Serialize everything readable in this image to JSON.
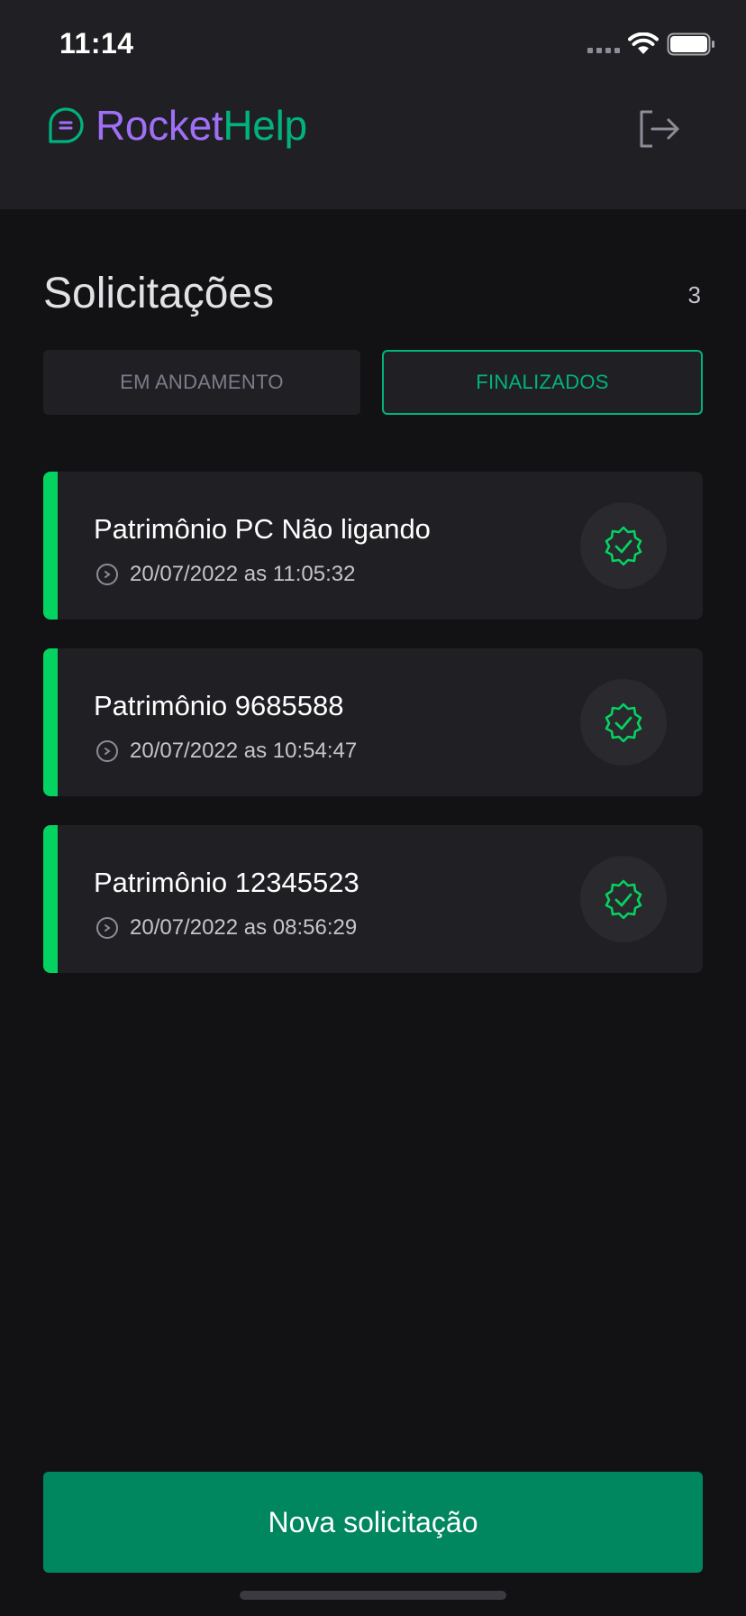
{
  "status_bar": {
    "time": "11:14"
  },
  "header": {
    "logo_part1": "Rocket",
    "logo_part2": "Help",
    "logo_icon": "chat-bubble-icon",
    "logout_icon": "sign-out-icon"
  },
  "main": {
    "title": "Solicitações",
    "count": "3",
    "filters": [
      {
        "label": "EM ANDAMENTO",
        "selected": false
      },
      {
        "label": "FINALIZADOS",
        "selected": true
      }
    ],
    "orders": [
      {
        "title": "Patrimônio PC Não ligando",
        "when": "20/07/2022 as 11:05:32",
        "status_icon": "check-badge-icon"
      },
      {
        "title": "Patrimônio 9685588",
        "when": "20/07/2022 as 10:54:47",
        "status_icon": "check-badge-icon"
      },
      {
        "title": "Patrimônio 12345523",
        "when": "20/07/2022 as 08:56:29",
        "status_icon": "check-badge-icon"
      }
    ]
  },
  "footer": {
    "new_button_label": "Nova solicitação"
  },
  "colors": {
    "background": "#121214",
    "header": "#202024",
    "accent_green": "#00b37e",
    "accent_purple": "#9f6ff5",
    "status_bar_green": "#04d361",
    "primary_button": "#00875f"
  }
}
